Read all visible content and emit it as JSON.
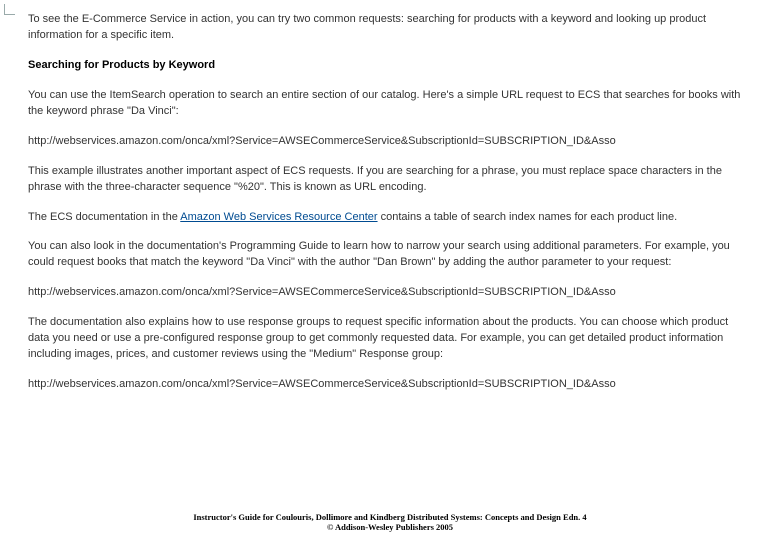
{
  "doc": {
    "intro": "To see the E-Commerce Service in action, you can try two common requests: searching for products with a keyword and looking up product information for a specific item.",
    "heading1": "Searching for Products by Keyword",
    "p1": "You can use the ItemSearch operation to search an entire section of our catalog. Here's a simple URL request to ECS that searches for books with the keyword phrase \"Da Vinci\":",
    "url1": "http://webservices.amazon.com/onca/xml?Service=AWSECommerceService&SubscriptionId=SUBSCRIPTION_ID&Asso",
    "p2": "This example illustrates another important aspect of ECS requests. If you are searching for a phrase, you must replace space characters in the phrase with the three-character sequence \"%20\". This is known as URL encoding.",
    "p3a": "The ECS documentation in the ",
    "link1": "Amazon Web Services Resource Center",
    "p3b": " contains a table of search index names for each product line.",
    "p4": "You can also look in the documentation's Programming Guide to learn how to narrow your search using additional parameters. For example, you could request books that match the keyword \"Da Vinci\" with the author \"Dan Brown\" by adding the author parameter to your request:",
    "url2": "http://webservices.amazon.com/onca/xml?Service=AWSECommerceService&SubscriptionId=SUBSCRIPTION_ID&Asso",
    "p5": "The documentation also explains how to use response groups to request specific information about the products. You can choose which product data you need or use a pre-configured response group to get commonly requested data. For example, you can get detailed product information including images, prices, and customer reviews using the \"Medium\" Response group:",
    "url3": "http://webservices.amazon.com/onca/xml?Service=AWSECommerceService&SubscriptionId=SUBSCRIPTION_ID&Asso"
  },
  "footer": {
    "line1": "Instructor's Guide for  Coulouris, Dollimore and Kindberg   Distributed Systems: Concepts and Design   Edn. 4",
    "line2": "©  Addison-Wesley Publishers 2005"
  }
}
